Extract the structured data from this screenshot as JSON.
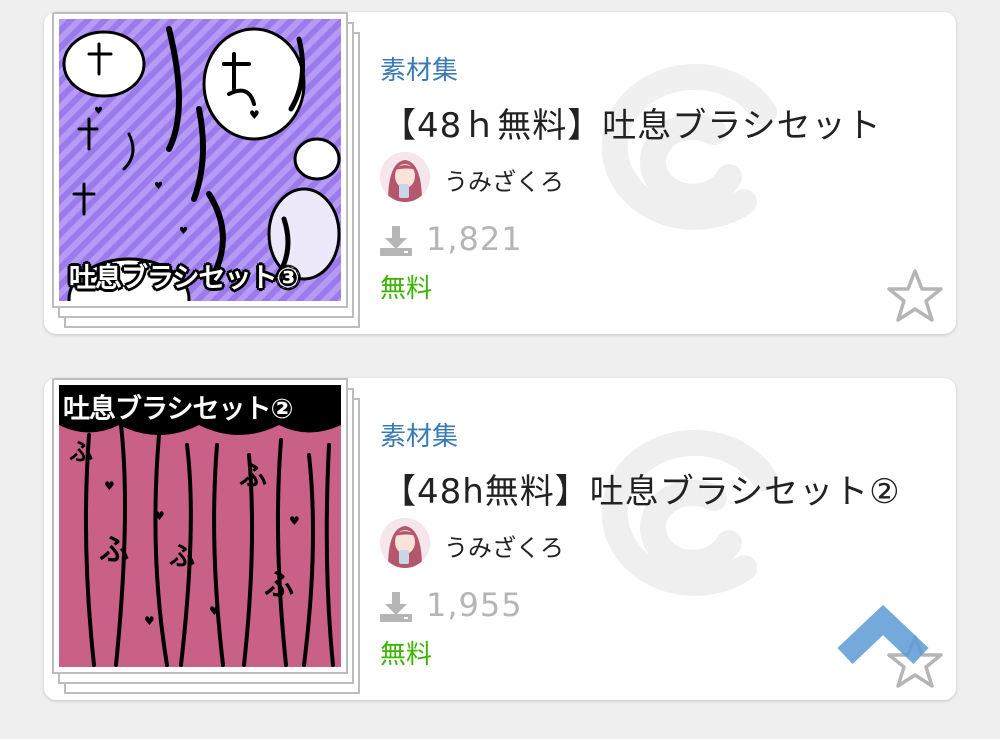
{
  "items": [
    {
      "category": "素材集",
      "title": "【48ｈ無料】吐息ブラシセット",
      "author": "うみざくろ",
      "downloads": "1,821",
      "price": "無料",
      "thumb_label": "吐息ブラシセット③",
      "thumb_color": "#a98af0"
    },
    {
      "category": "素材集",
      "title": "【48h無料】吐息ブラシセット②",
      "author": "うみざくろ",
      "downloads": "1,955",
      "price": "無料",
      "thumb_label": "吐息ブラシセット②",
      "thumb_color": "#c86088"
    }
  ],
  "icons": {
    "download": "download-icon",
    "favorite": "star-outline-icon",
    "scroll_top": "chevron-up-icon"
  },
  "colors": {
    "category": "#3a7bb6",
    "price_free": "#3bb300",
    "scroll_top": "#5b9bd5"
  }
}
